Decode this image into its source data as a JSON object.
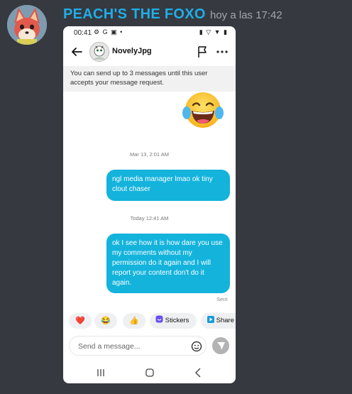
{
  "discord": {
    "author": "PEACH'S THE FOXO",
    "timestamp": "hoy a las 17:42"
  },
  "phone": {
    "status_bar": {
      "time": "00:41",
      "left_icons": "⚙ G ▣ •",
      "right_icons": "▮ ▽ ▼ ▮"
    },
    "header": {
      "contact_name": "NovelyJpg"
    },
    "limit_banner": "You can send up to 3 messages until this user accepts your message request.",
    "emoji_message": "😂",
    "messages": [
      {
        "date_separator": "Mar 13, 2:01 AM",
        "text": "ngl media manager lmao ok tiny clout chaser"
      },
      {
        "date_separator": "Today 12:41 AM",
        "text": "ok I see how it is how dare you use my comments without my permission  do it again and I will report your content don't do it again."
      }
    ],
    "sent_status": "Sent",
    "quick_reactions": [
      "❤️",
      "😂",
      "👍"
    ],
    "quick_actions": {
      "stickers": "Stickers",
      "share": "Share"
    },
    "composer": {
      "placeholder": "Send a message..."
    }
  },
  "colors": {
    "discord_bg": "#36393f",
    "author_color": "#1eaee8",
    "bubble_color": "#13b3dc"
  }
}
